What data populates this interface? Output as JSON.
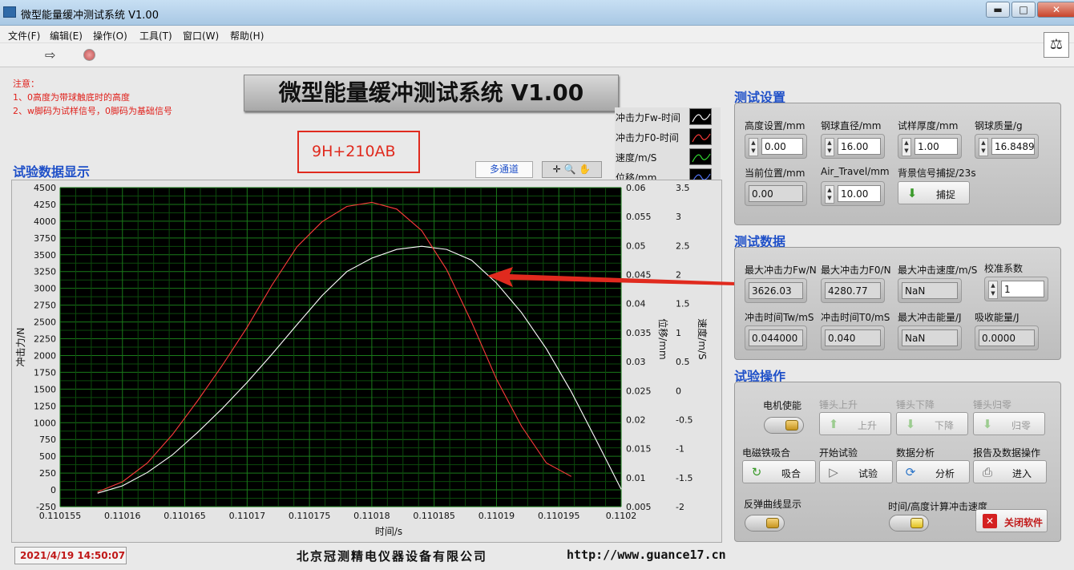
{
  "window": {
    "title": "微型能量缓冲测试系统 V1.00",
    "minimize": "▬",
    "maximize": "□",
    "close": "✕"
  },
  "menu": [
    "文件(F)",
    "编辑(E)",
    "操作(O)",
    "工具(T)",
    "窗口(W)",
    "帮助(H)"
  ],
  "notes": {
    "heading": "注意：",
    "line1": "1、0高度为带球触底时的高度",
    "line2": "2、w脚码为试样信号，0脚码为基础信号"
  },
  "main_title": "微型能量缓冲测试系统 V1.00",
  "sample_id": "9H+210AB",
  "chart_section_label": "试验数据显示",
  "channel_button": "多通道",
  "legend": [
    {
      "label": "冲击力Fw-时间",
      "color": "#ffffff"
    },
    {
      "label": "冲击力F0-时间",
      "color": "#ff3b3b"
    },
    {
      "label": "速度/m/S",
      "color": "#33dd33"
    },
    {
      "label": "位移/mm",
      "color": "#5577ff"
    }
  ],
  "chart_data": {
    "type": "line",
    "xlabel": "时间/s",
    "ylabel": "冲击力/N",
    "y2label": "位移/mm",
    "y3label": "速度/m/S",
    "xlim": [
      0.110155,
      0.1102
    ],
    "ylim": [
      -250,
      4500
    ],
    "y2lim": [
      0.005,
      0.06
    ],
    "y3lim": [
      -2,
      3.5
    ],
    "x_ticks": [
      "0.110155",
      "0.11016",
      "0.110165",
      "0.11017",
      "0.110175",
      "0.11018",
      "0.110185",
      "0.11019",
      "0.110195",
      "0.1102"
    ],
    "y_ticks": [
      "4500",
      "4250",
      "4000",
      "3750",
      "3500",
      "3250",
      "3000",
      "2750",
      "2500",
      "2250",
      "2000",
      "1750",
      "1500",
      "1250",
      "1000",
      "750",
      "500",
      "250",
      "0",
      "-250"
    ],
    "y2_ticks": [
      "0.06",
      "0.055",
      "0.05",
      "0.045",
      "0.04",
      "0.035",
      "0.03",
      "0.025",
      "0.02",
      "0.015",
      "0.01",
      "0.005"
    ],
    "y3_ticks": [
      "3.5",
      "3",
      "2.5",
      "2",
      "1.5",
      "1",
      "0.5",
      "0",
      "-0.5",
      "-1",
      "-1.5",
      "-2"
    ],
    "grid": true,
    "series": [
      {
        "name": "冲击力Fw-时间",
        "color": "#ffffff",
        "x": [
          0.110158,
          0.11016,
          0.110162,
          0.110164,
          0.110166,
          0.110168,
          0.11017,
          0.110172,
          0.110174,
          0.110176,
          0.110178,
          0.11018,
          0.110182,
          0.110184,
          0.110186,
          0.110188,
          0.11019,
          0.110192,
          0.110194,
          0.110196,
          0.110198,
          0.1102
        ],
        "y": [
          -50,
          60,
          260,
          520,
          850,
          1210,
          1600,
          2020,
          2460,
          2890,
          3250,
          3450,
          3580,
          3626,
          3580,
          3420,
          3080,
          2640,
          2100,
          1460,
          740,
          10
        ]
      },
      {
        "name": "冲击力F0-时间",
        "color": "#ff3b3b",
        "x": [
          0.110158,
          0.11016,
          0.110162,
          0.110164,
          0.110166,
          0.110168,
          0.11017,
          0.110172,
          0.110174,
          0.110176,
          0.110178,
          0.11018,
          0.110182,
          0.110184,
          0.110186,
          0.110188,
          0.11019,
          0.110192,
          0.110194,
          0.110196
        ],
        "y": [
          -30,
          120,
          400,
          820,
          1320,
          1850,
          2420,
          3050,
          3620,
          3990,
          4220,
          4280,
          4180,
          3860,
          3280,
          2500,
          1650,
          950,
          400,
          200
        ]
      }
    ]
  },
  "settings": {
    "section_label": "测试设置",
    "height_label": "高度设置/mm",
    "height_value": "0.00",
    "ball_diameter_label": "钢球直径/mm",
    "ball_diameter_value": "16.00",
    "thickness_label": "试样厚度/mm",
    "thickness_value": "1.00",
    "ball_mass_label": "钢球质量/g",
    "ball_mass_value": "16.8489",
    "position_label": "当前位置/mm",
    "position_value": "0.00",
    "air_travel_label": "Air_Travel/mm",
    "air_travel_value": "10.00",
    "background_label": "背景信号捕捉/23s",
    "capture_button": "捕捉"
  },
  "results": {
    "section_label": "测试数据",
    "max_fw_label": "最大冲击力Fw/N",
    "max_fw_value": "3626.03",
    "max_f0_label": "最大冲击力F0/N",
    "max_f0_value": "4280.77",
    "max_speed_label": "最大冲击速度/m/S",
    "max_speed_value": "NaN",
    "calib_label": "校准系数",
    "calib_value": "1",
    "tw_label": "冲击时间Tw/mS",
    "tw_value": "0.044000",
    "t0_label": "冲击时间T0/mS",
    "t0_value": "0.040",
    "max_energy_label": "最大冲击能量/J",
    "max_energy_value": "NaN",
    "absorbed_label": "吸收能量/J",
    "absorbed_value": "0.0000"
  },
  "operations": {
    "section_label": "试验操作",
    "motor_label": "电机使能",
    "up_label": "锤头上升",
    "up_button": "上升",
    "down_label": "锤头下降",
    "down_button": "下降",
    "home_label": "锤头归零",
    "home_button": "归零",
    "magnet_label": "电磁铁吸合",
    "magnet_button": "吸合",
    "start_label": "开始试验",
    "start_button": "试验",
    "analysis_label": "数据分析",
    "analysis_button": "分析",
    "report_label": "报告及数据操作",
    "report_button": "进入",
    "rebound_label": "反弹曲线显示",
    "speed_calc_label": "时间/高度计算冲击速度",
    "close_button": "关闭软件"
  },
  "status": {
    "timestamp": "2021/4/19  14:50:07",
    "company": "北京冠测精电仪器设备有限公司",
    "website": "http://www.guance17.cn"
  }
}
